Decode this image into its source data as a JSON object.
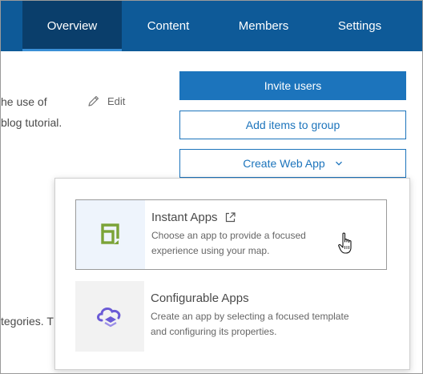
{
  "nav": {
    "tabs": [
      {
        "label": "Overview",
        "active": true
      },
      {
        "label": "Content",
        "active": false
      },
      {
        "label": "Members",
        "active": false
      },
      {
        "label": "Settings",
        "active": false
      }
    ]
  },
  "description": {
    "line1": "he use of",
    "line2": "blog tutorial.",
    "line3": "tegories. T",
    "edit_label": "Edit"
  },
  "actions": {
    "invite_label": "Invite users",
    "add_items_label": "Add items to group",
    "create_app_label": "Create Web App"
  },
  "dropdown": {
    "items": [
      {
        "title": "Instant Apps",
        "desc1": "Choose an app to provide a focused",
        "desc2": "experience using your map.",
        "icon": "instant-apps-icon"
      },
      {
        "title": "Configurable Apps",
        "desc1": "Create an app by selecting a focused template",
        "desc2": "and configuring its properties.",
        "icon": "configurable-apps-icon"
      }
    ]
  },
  "colors": {
    "nav_bg": "#0e5a98",
    "nav_active": "#0a3e6b",
    "accent": "#1c74bc",
    "instant_green": "#7ba337",
    "config_purple": "#6b5bd6"
  }
}
